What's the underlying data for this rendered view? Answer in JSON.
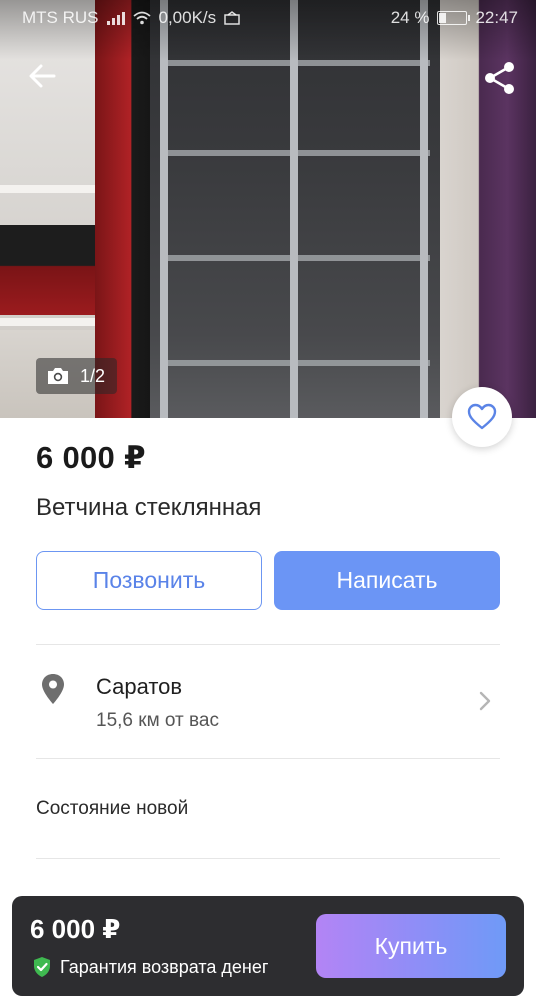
{
  "status_bar": {
    "carrier": "MTS RUS",
    "speed": "0,00K/s",
    "battery": "24 %",
    "battery_level": 0.24,
    "time": "22:47"
  },
  "gallery": {
    "counter": "1/2",
    "current": 1,
    "total": 2
  },
  "listing": {
    "price": "6 000 ₽",
    "title": "Ветчина стеклянная"
  },
  "actions": {
    "call_label": "Позвонить",
    "write_label": "Написать"
  },
  "location": {
    "city": "Саратов",
    "distance": "15,6 км от вас"
  },
  "details": {
    "condition": "Состояние новой"
  },
  "buy_bar": {
    "price": "6 000 ₽",
    "guarantee": "Гарантия возврата денег",
    "buy_label": "Купить"
  },
  "colors": {
    "accent_blue": "#6b95f5",
    "buy_gradient_start": "#b384f5",
    "buy_gradient_end": "#6f9af7",
    "guarantee_green": "#3fb950",
    "buy_bar_bg": "#2d2d30"
  },
  "icons": {
    "back": "arrow-left-icon",
    "share": "share-icon",
    "camera": "camera-icon",
    "favorite": "heart-icon",
    "location": "map-pin-icon",
    "chevron": "chevron-right-icon",
    "guarantee": "shield-check-icon"
  }
}
